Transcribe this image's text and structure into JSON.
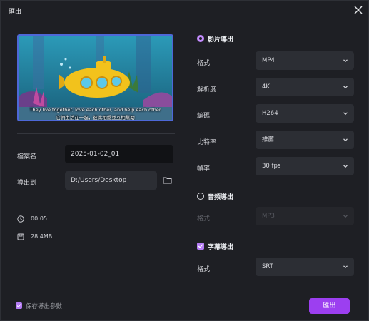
{
  "window": {
    "title": "匯出"
  },
  "preview": {
    "subtitle_en": "They live together, love each other, and help each other",
    "subtitle_zh": "它們生活在一起，彼此相愛並互相幫助"
  },
  "left": {
    "filename_label": "檔案名",
    "filename_value": "2025-01-02_01",
    "export_to_label": "導出到",
    "path_value": "D:/Users/Desktop",
    "duration": "00:05",
    "size": "28.4MB"
  },
  "video": {
    "section": "影片導出",
    "format_label": "格式",
    "format_value": "MP4",
    "resolution_label": "解析度",
    "resolution_value": "4K",
    "codec_label": "編碼",
    "codec_value": "H264",
    "bitrate_label": "比特率",
    "bitrate_value": "推薦",
    "framerate_label": "幀率",
    "framerate_value": "30 fps"
  },
  "audio": {
    "section": "音頻導出",
    "format_label": "格式",
    "format_value": "MP3"
  },
  "subtitle": {
    "section": "字幕導出",
    "format_label": "格式",
    "format_value": "SRT"
  },
  "footer": {
    "save_label": "保存導出參數",
    "export_button": "匯出"
  },
  "colors": {
    "accent": "#9c3ff0",
    "checkbox": "#b57cf5",
    "preview_border": "#4d68d8"
  }
}
